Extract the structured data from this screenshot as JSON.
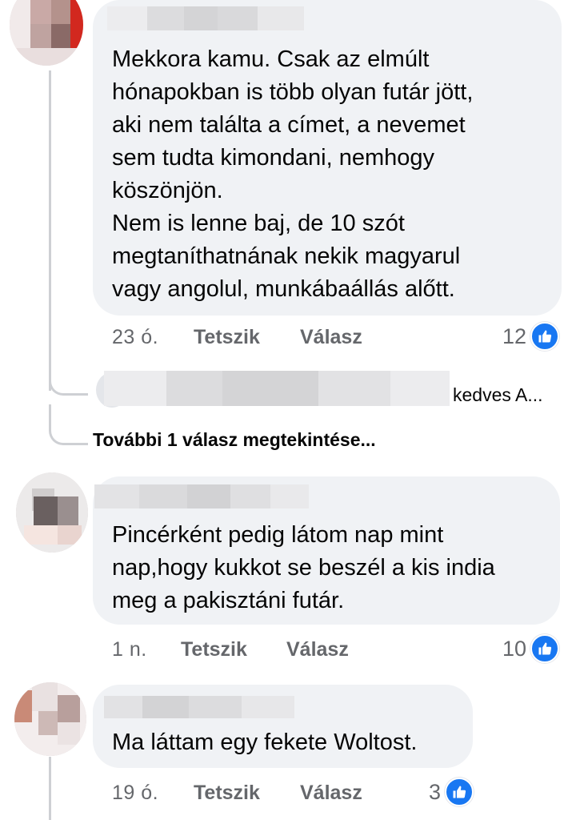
{
  "comments": [
    {
      "text": "Mekkora kamu. Csak az elmúlt\nhónapokban is több olyan futár jött,\naki nem találta a címet, a nevemet\nsem tudta kimondani, nemhogy\nköszönjön.\nNem is lenne baj, de 10 szót\nmegtaníthatnának nekik magyarul\nvagy angolul, munkábaállás alőtt.",
      "time": "23 ó.",
      "like_label": "Tetszik",
      "reply_label": "Válasz",
      "reaction_count": "12"
    },
    {
      "text": "Pincérként pedig látom nap mint\nnap,hogy kukkot se beszél a kis india\nmeg a pakisztáni futár.",
      "time": "1 n.",
      "like_label": "Tetszik",
      "reply_label": "Válasz",
      "reaction_count": "10"
    },
    {
      "text": "Ma láttam egy fekete Woltost.",
      "time": "19 ó.",
      "like_label": "Tetszik",
      "reply_label": "Válasz",
      "reaction_count": "3"
    }
  ],
  "reply_preview": {
    "snippet": "kedves A..."
  },
  "more_replies_label": "További 1 válasz megtekintése...",
  "colors": {
    "bubble": "#f0f2f5",
    "meta": "#65676b",
    "like": "#1877f2",
    "thread_line": "#ced0d4"
  },
  "icons": [
    "thumbs-up-icon"
  ]
}
